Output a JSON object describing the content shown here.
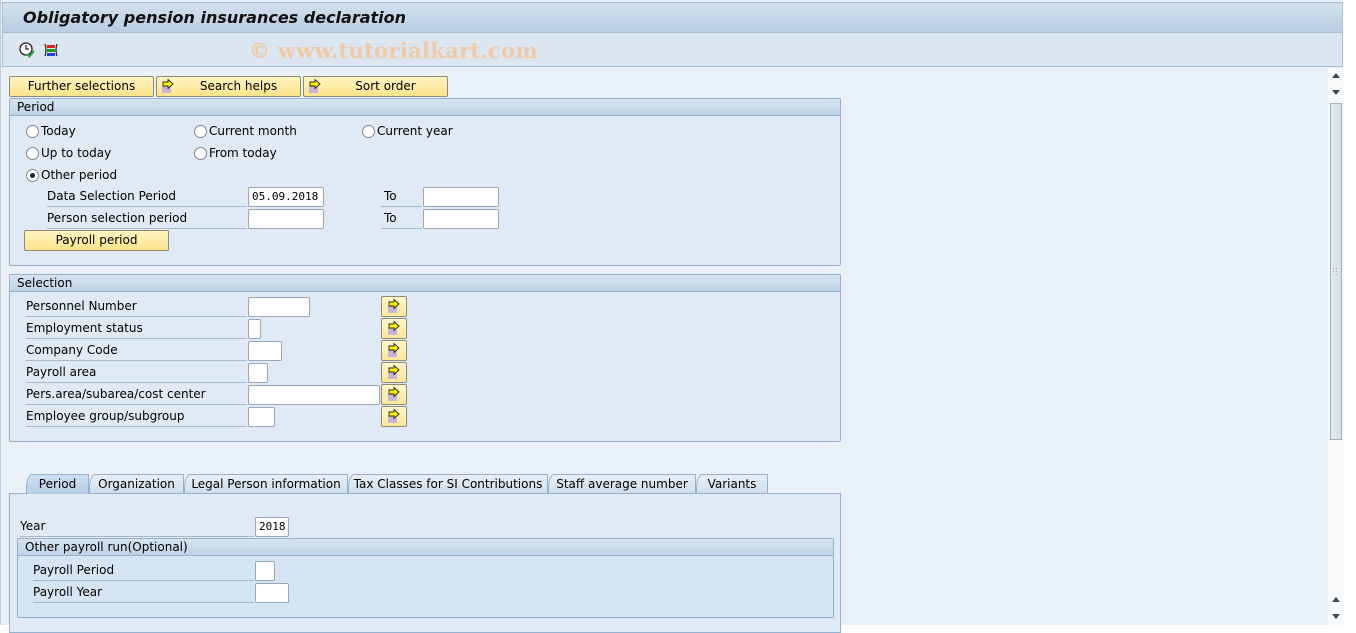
{
  "window": {
    "title": "Obligatory pension insurances declaration"
  },
  "toolbar": {
    "icons": [
      "execute-clock-check-icon",
      "selection-options-icon"
    ],
    "watermark": "© www.tutorialkart.com"
  },
  "buttons": {
    "further_selections": "Further selections",
    "search_helps": "Search helps",
    "sort_order": "Sort order"
  },
  "period": {
    "title": "Period",
    "radios": [
      {
        "label": "Today",
        "selected": false
      },
      {
        "label": "Current month",
        "selected": false
      },
      {
        "label": "Current year",
        "selected": false
      },
      {
        "label": "Up to today",
        "selected": false
      },
      {
        "label": "From today",
        "selected": false
      },
      {
        "label": "Other period",
        "selected": true
      }
    ],
    "data_selection_label": "Data Selection Period",
    "data_selection_from": "05.09.2018",
    "data_selection_to": "",
    "person_selection_label": "Person selection period",
    "person_selection_from": "",
    "person_selection_to": "",
    "to_label": "To",
    "payroll_period_button": "Payroll period"
  },
  "selection": {
    "title": "Selection",
    "fields": [
      {
        "label": "Personnel Number",
        "value": ""
      },
      {
        "label": "Employment status",
        "value": ""
      },
      {
        "label": "Company Code",
        "value": ""
      },
      {
        "label": "Payroll area",
        "value": ""
      },
      {
        "label": "Pers.area/subarea/cost center",
        "value": ""
      },
      {
        "label": "Employee group/subgroup",
        "value": ""
      }
    ]
  },
  "tabs": [
    {
      "label": "Period",
      "active": true
    },
    {
      "label": "Organization",
      "active": false
    },
    {
      "label": "Legal Person information",
      "active": false
    },
    {
      "label": "Tax Classes for SI Contributions",
      "active": false
    },
    {
      "label": "Staff average number",
      "active": false
    },
    {
      "label": "Variants",
      "active": false
    }
  ],
  "tab_period": {
    "year_label": "Year",
    "year_value": "2018",
    "other_run_title": "Other payroll run(Optional)",
    "payroll_period_label": "Payroll Period",
    "payroll_period_value": "",
    "payroll_year_label": "Payroll Year",
    "payroll_year_value": ""
  }
}
